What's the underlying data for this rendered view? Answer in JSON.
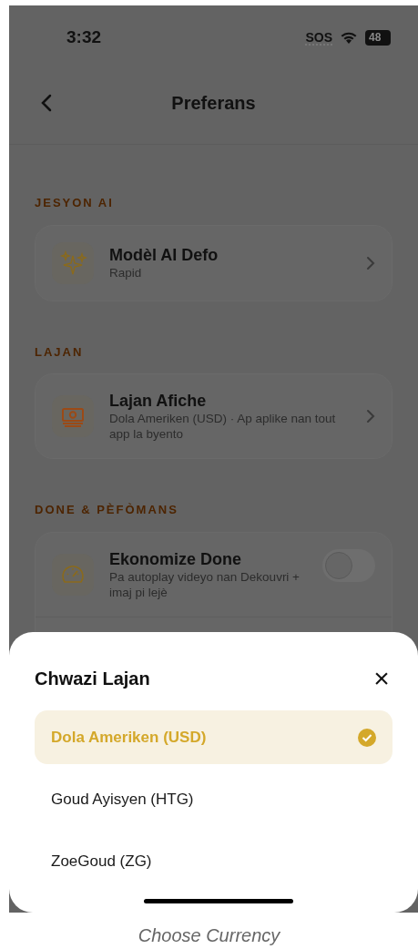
{
  "status_bar": {
    "time": "3:32",
    "sos": "SOS",
    "battery": "48"
  },
  "header": {
    "title": "Preferans"
  },
  "sections": [
    {
      "title": "JESYON AI",
      "items": [
        {
          "kind": "link",
          "title": "Modèl AI Defo",
          "subtitle": "Rapid"
        }
      ]
    },
    {
      "title": "LAJAN",
      "items": [
        {
          "kind": "link",
          "title": "Lajan Afiche",
          "subtitle": "Dola Ameriken (USD) · Ap aplike nan tout app la byento"
        }
      ]
    },
    {
      "title": "DONE & PÈFÒMANS",
      "items": [
        {
          "kind": "toggle",
          "title": "Ekonomize Done",
          "subtitle": "Pa autoplay videyo nan Dekouvri + imaj pi lejè",
          "on": false
        }
      ]
    }
  ],
  "sheet": {
    "title": "Chwazi Lajan",
    "close": "×",
    "options": [
      {
        "label": "Dola Ameriken (USD)",
        "selected": true
      },
      {
        "label": "Goud Ayisyen (HTG)",
        "selected": false
      },
      {
        "label": "ZoeGoud (ZG)",
        "selected": false
      }
    ]
  },
  "caption": "Choose Currency"
}
